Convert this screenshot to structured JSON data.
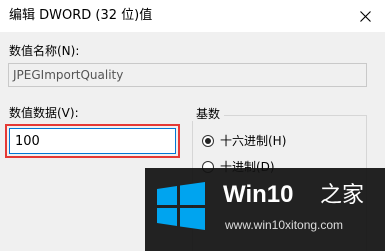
{
  "dialog": {
    "title": "编辑 DWORD (32 位)值",
    "close_glyph": "✕",
    "name_label": "数值名称(N):",
    "name_value": "JPEGImportQuality",
    "data_label": "数值数据(V):",
    "data_value": "100",
    "base_label": "基数",
    "base_options": [
      {
        "label": "十六进制(H)",
        "selected": true
      },
      {
        "label": "十进制(D)",
        "selected": false
      }
    ],
    "highlight_color": "#e53935"
  },
  "watermark": {
    "brand": "Win10",
    "suffix": "之家",
    "url": "www.win10xitong.com",
    "logo_color": "#00a4ef"
  }
}
